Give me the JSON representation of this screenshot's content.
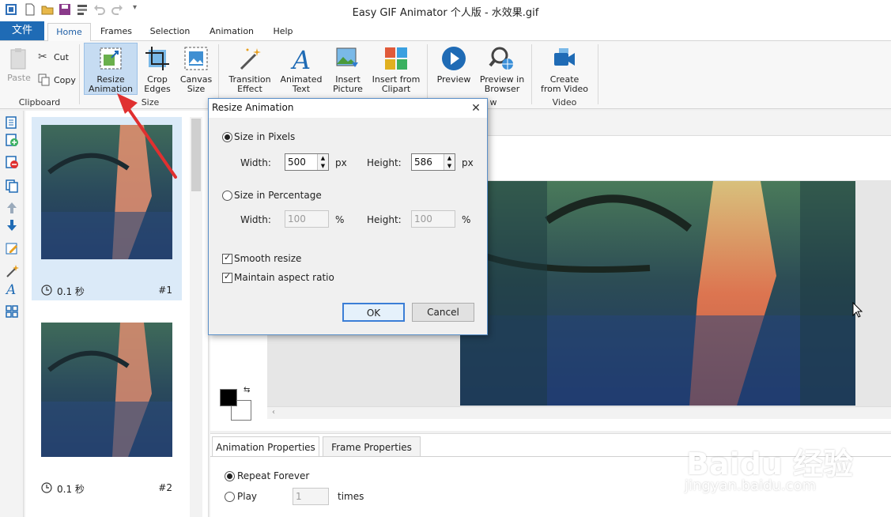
{
  "window": {
    "title": "Easy GIF Animator 个人版 - 水效果.gif"
  },
  "menu": {
    "file_label": "文件",
    "tabs": [
      "Home",
      "Frames",
      "Selection",
      "Animation",
      "Help"
    ]
  },
  "ribbon": {
    "paste": "Paste",
    "cut": "Cut",
    "copy": "Copy",
    "clipboard_group": "Clipboard",
    "resize_l1": "Resize",
    "resize_l2": "Animation",
    "crop_l1": "Crop",
    "crop_l2": "Edges",
    "canvas_l1": "Canvas",
    "canvas_l2": "Size",
    "size_group": "Size",
    "transition_l1": "Transition",
    "transition_l2": "Effect",
    "animtext_l1": "Animated",
    "animtext_l2": "Text",
    "insertpic_l1": "Insert",
    "insertpic_l2": "Picture",
    "clipart_l1": "Insert from",
    "clipart_l2": "Clipart",
    "preview": "Preview",
    "browser_l1": "Preview in",
    "browser_l2": "Browser",
    "preview_group": "w",
    "video_l1": "Create",
    "video_l2": "from Video",
    "video_group": "Video"
  },
  "frames": [
    {
      "delay": "0.1 秒",
      "number": "#1"
    },
    {
      "delay": "0.1 秒",
      "number": "#2"
    }
  ],
  "properties": {
    "tab_animation": "Animation Properties",
    "tab_frame": "Frame Properties",
    "repeat_forever": "Repeat Forever",
    "play": "Play",
    "play_count": "1",
    "times": "times"
  },
  "dialog": {
    "title": "Resize Animation",
    "close": "✕",
    "size_pixels": "Size in Pixels",
    "width_label": "Width:",
    "height_label": "Height:",
    "width_px": "500",
    "height_px": "586",
    "px": "px",
    "size_percent": "Size in Percentage",
    "width_pct": "100",
    "height_pct": "100",
    "pct": "%",
    "smooth_resize": "Smooth resize",
    "maintain_aspect": "Maintain aspect ratio",
    "ok": "OK",
    "cancel": "Cancel"
  },
  "watermark": {
    "brand": "Baidu 经验",
    "url": "jingyan.baidu.com"
  },
  "colors": {
    "accent": "#1f6bb5",
    "selection": "#c6dcf2",
    "highlight_arrow": "#e03030"
  }
}
